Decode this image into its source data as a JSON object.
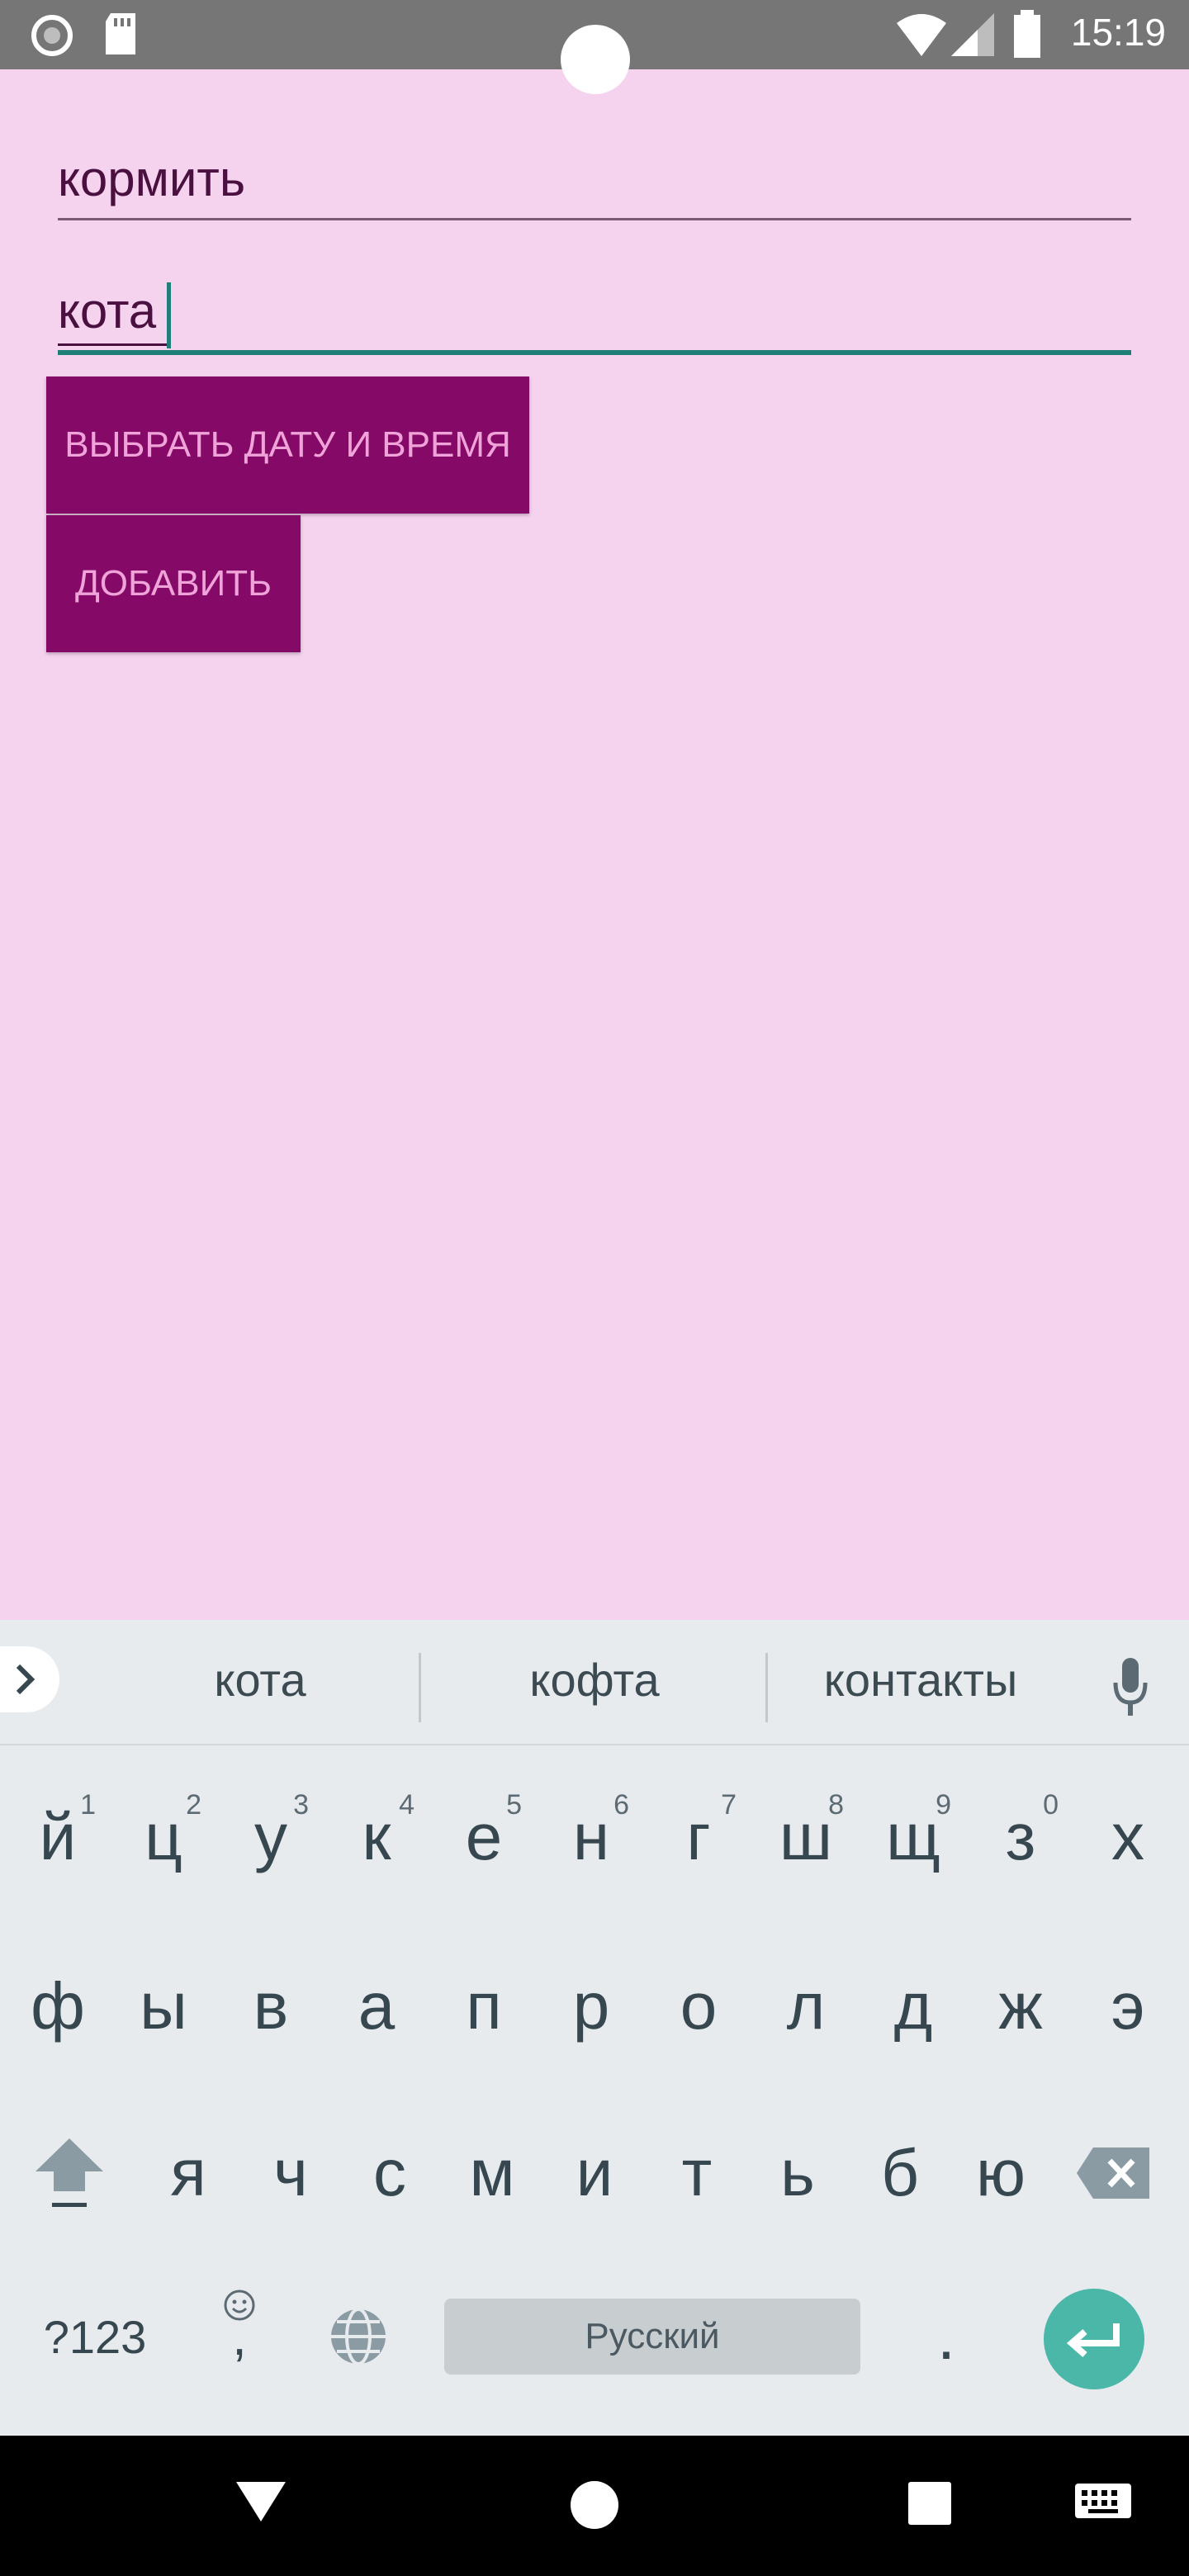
{
  "status_bar": {
    "time": "15:19"
  },
  "form": {
    "field1_value": "кормить",
    "field2_value": "кота",
    "pick_datetime_label": "ВЫБРАТЬ ДАТУ И ВРЕМЯ",
    "add_label": "ДОБАВИТЬ"
  },
  "keyboard": {
    "suggestions": [
      "кота",
      "кофта",
      "контакты"
    ],
    "row1": [
      "й",
      "ц",
      "у",
      "к",
      "е",
      "н",
      "г",
      "ш",
      "щ",
      "з",
      "х"
    ],
    "row1_hints": [
      "1",
      "2",
      "3",
      "4",
      "5",
      "6",
      "7",
      "8",
      "9",
      "0"
    ],
    "row2": [
      "ф",
      "ы",
      "в",
      "а",
      "п",
      "р",
      "о",
      "л",
      "д",
      "ж",
      "э"
    ],
    "row3": [
      "я",
      "ч",
      "с",
      "м",
      "и",
      "т",
      "ь",
      "б",
      "ю"
    ],
    "symbols_label": "?123",
    "comma_label": ",",
    "space_label": "Русский",
    "period_label": "."
  },
  "colors": {
    "background": "#f5d3ef",
    "button": "#850a68",
    "button_text": "#f0a3d9",
    "accent": "#1e7f77",
    "enter_key": "#4bb7a8"
  }
}
